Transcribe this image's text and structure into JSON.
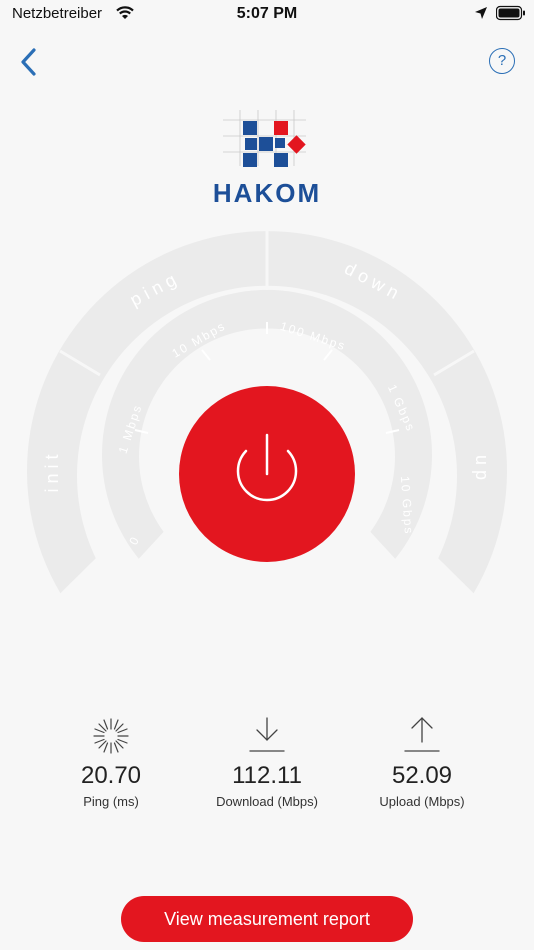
{
  "status_bar": {
    "carrier": "Netzbetreiber",
    "time": "5:07 PM"
  },
  "header": {
    "help_label": "?"
  },
  "logo": {
    "text": "HAKOM"
  },
  "gauge": {
    "outer_segments": [
      "init",
      "ping",
      "down",
      "up"
    ],
    "scale_labels": [
      "0",
      "1 Mbps",
      "10 Mbps",
      "100 Mbps",
      "1 Gbps",
      "10 Gbps"
    ]
  },
  "metrics": {
    "ping": {
      "value": "20.70",
      "label": "Ping (ms)"
    },
    "download": {
      "value": "112.11",
      "label": "Download (Mbps)"
    },
    "upload": {
      "value": "52.09",
      "label": "Upload (Mbps)"
    }
  },
  "report_button": {
    "label": "View measurement report"
  },
  "colors": {
    "accent": "#e3161f",
    "brand_blue": "#1d4f98",
    "gauge_gray": "#ebebeb"
  }
}
